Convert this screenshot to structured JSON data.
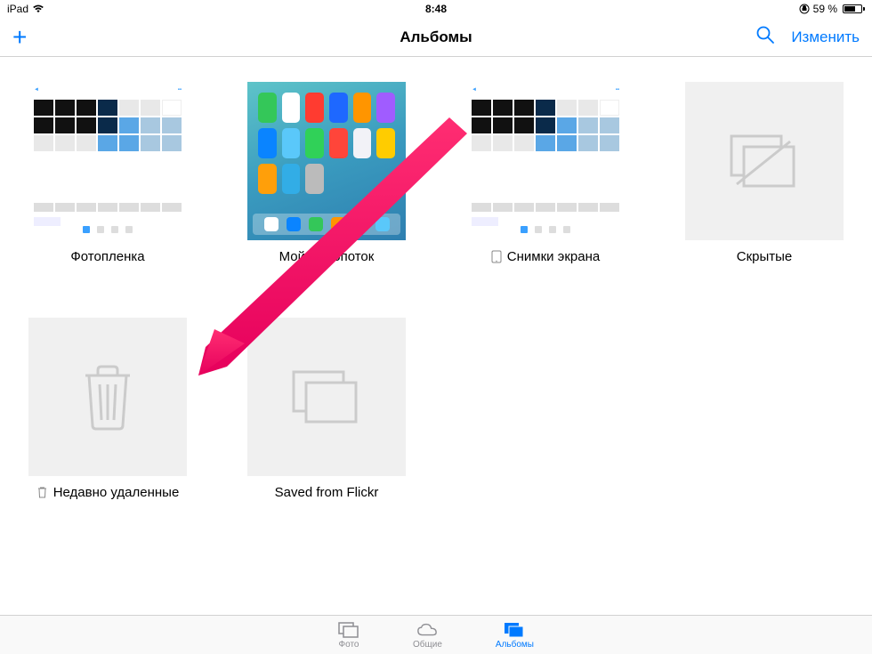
{
  "status": {
    "device": "iPad",
    "time": "8:48",
    "battery_text": "59 %",
    "battery_pct": 59
  },
  "nav": {
    "title": "Альбомы",
    "edit_label": "Изменить"
  },
  "albums": [
    {
      "label": "Фотопленка",
      "icon": null
    },
    {
      "label": "Мой фотопоток",
      "icon": null
    },
    {
      "label": "Снимки экрана",
      "icon": "device"
    },
    {
      "label": "Скрытые",
      "icon": null
    },
    {
      "label": "Недавно удаленные",
      "icon": "trash"
    },
    {
      "label": "Saved from Flickr",
      "icon": null
    }
  ],
  "tabs": {
    "photos": "Фото",
    "shared": "Общие",
    "albums": "Альбомы"
  }
}
